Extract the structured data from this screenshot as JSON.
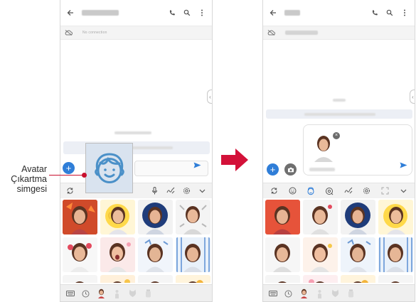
{
  "callout": {
    "label_line1": "Avatar",
    "label_line2": "Çıkartma",
    "label_line3": "simgesi"
  },
  "left_screen": {
    "status_text": "No connection",
    "icons": [
      "back-arrow-icon",
      "phone-icon",
      "search-icon",
      "more-vert-icon"
    ],
    "toolbar_icons": [
      "sync-icon",
      "emoji-icon",
      "avatar-sticker-icon",
      "microphone-icon",
      "handwriting-icon",
      "settings-icon",
      "chevron-down-icon"
    ],
    "bottom_nav_icons": [
      "keyboard-icon",
      "clock-icon",
      "avatar-icon",
      "figure-icon",
      "cat-icon",
      "jar-icon"
    ]
  },
  "right_screen": {
    "icons": [
      "back-arrow-icon",
      "phone-icon",
      "search-icon",
      "more-vert-icon"
    ],
    "toolbar_icons": [
      "sync-icon",
      "emoji-icon",
      "avatar-sticker-icon",
      "gif-icon",
      "handwriting-icon",
      "settings-icon",
      "expand-icon",
      "chevron-down-icon"
    ],
    "bottom_nav_icons": [
      "keyboard-icon",
      "clock-icon",
      "avatar-icon",
      "figure-icon",
      "cat-icon",
      "jar-icon"
    ]
  },
  "colors": {
    "accent_blue": "#2f7ed8",
    "callout_red": "#c8102e",
    "arrow_red": "#d31139",
    "avatar_icon_blue": "#4a90c8"
  }
}
